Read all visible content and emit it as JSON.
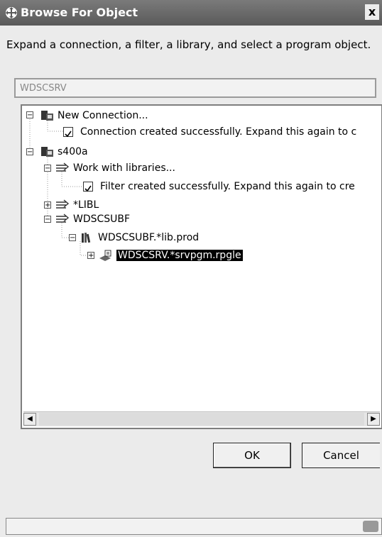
{
  "window": {
    "title": "Browse For Object",
    "close_glyph": "x"
  },
  "instructions": "Expand a connection, a filter, a library, and select a program object.",
  "object_field": {
    "value": "WDSCSRV"
  },
  "tree": {
    "nodes": [
      {
        "label": "New Connection...",
        "expander": "−",
        "icon": "connection-icon"
      },
      {
        "label": "Connection created successfully. Expand this again to c",
        "icon": "checkbox-icon"
      },
      {
        "label": "s400a",
        "expander": "−",
        "icon": "connection-icon"
      },
      {
        "label": "Work with libraries...",
        "expander": "−",
        "icon": "filter-icon"
      },
      {
        "label": "Filter created successfully. Expand this again to cre",
        "icon": "checkbox-icon"
      },
      {
        "label": "*LIBL",
        "expander": "+",
        "icon": "filter-icon"
      },
      {
        "label": "WDSCSUBF",
        "expander": "−",
        "icon": "filter-icon"
      },
      {
        "label": "WDSCSUBF.*lib.prod",
        "expander": "−",
        "icon": "library-icon"
      },
      {
        "label": "WDSCSRV.*srvpgm.rpgle",
        "expander": "+",
        "icon": "program-object-icon",
        "selected": true
      }
    ]
  },
  "scrollbar": {
    "left_glyph": "◀",
    "right_glyph": "▶"
  },
  "buttons": {
    "ok": "OK",
    "cancel": "Cancel"
  }
}
